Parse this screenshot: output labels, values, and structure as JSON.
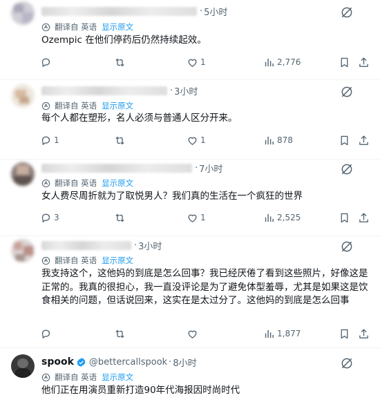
{
  "tweets": [
    {
      "time": "5小时",
      "translated_from": "翻译自 英语",
      "show_original": "显示原文",
      "text": "Ozempic 在他们停药后仍然持续起效。",
      "replies": "",
      "likes": "1",
      "views": "2,776"
    },
    {
      "time": "3小时",
      "translated_from": "翻译自 英语",
      "show_original": "显示原文",
      "text": "每个人都在塑形，名人必须与普通人区分开来。",
      "replies": "1",
      "likes": "1",
      "views": "878"
    },
    {
      "time": "7小时",
      "translated_from": "翻译自 英语",
      "show_original": "显示原文",
      "text": "女人费尽周折就为了取悦男人？我们真的生活在一个疯狂的世界",
      "replies": "3",
      "likes": "1",
      "views": "2,525"
    },
    {
      "time": "3小时",
      "translated_from": "翻译自 英语",
      "show_original": "显示原文",
      "text": "我支持这个，这他妈的到底是怎么回事？我已经厌倦了看到这些照片，好像这是正常的。我真的很担心，我一直没评论是为了避免体型羞辱，尤其是如果这是饮食相关的问题，但话说回来，这实在是太过分了。这他妈的到底是怎么回事",
      "replies": "",
      "likes": "",
      "views": "1,877"
    },
    {
      "name": "spook",
      "handle": "@bettercallspook",
      "time": "8小时",
      "translated_from": "翻译自 英语",
      "show_original": "显示原文",
      "text": "他们正在用演员重新打造90年代海报因时尚时代"
    }
  ],
  "separator": "·",
  "icons": [
    "grok-sparkle-icon",
    "translate-icon",
    "reply-icon",
    "retweet-icon",
    "like-icon",
    "views-icon",
    "bookmark-icon",
    "share-icon",
    "verified-badge-icon"
  ],
  "colors": {
    "accent": "#1d9bf0",
    "muted": "#536471",
    "text": "#0f1419",
    "divider": "#eff3f4"
  }
}
